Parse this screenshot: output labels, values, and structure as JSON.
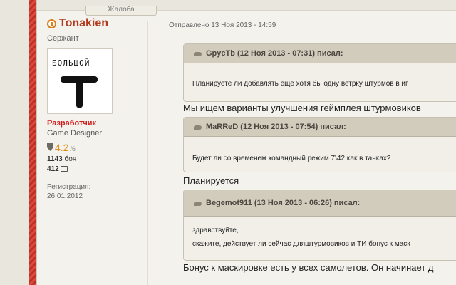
{
  "top_button": {
    "label": "Жалоба"
  },
  "author": {
    "name": "Tonakien",
    "rank": "Сержант",
    "avatar_text": "БОЛЬШОЙ",
    "role": "Разработчик",
    "position": "Game Designer",
    "rating": "4.2",
    "rating_max": "/6",
    "battles_value": "1143",
    "battles_label": "боя",
    "comments_value": "412",
    "reg_label": "Регистрация:",
    "reg_date": "26.01.2012"
  },
  "post": {
    "sent": "Отправлено 13 Ноя 2013 - 14:59"
  },
  "blocks": [
    {
      "quote_header": "GpycTb (12 Ноя 2013 - 07:31) писал:",
      "quote_lines": [
        "Планируете ли добавлять еще хотя бы одну ветрку штурмов в иг"
      ],
      "reply": "Мы ищем варианты улучшения геймплея штурмовиков"
    },
    {
      "quote_header": "MaRReD (12 Ноя 2013 - 07:54) писал:",
      "quote_lines": [
        "Будет ли со временем командный режим 7\\42 как в танках?"
      ],
      "reply": "Планируется"
    },
    {
      "quote_header": "Begemot911 (13 Ноя 2013 - 06:26) писал:",
      "quote_lines": [
        "здравствуйте,",
        "скажите, действует ли сейчас дляштурмовиков и ТИ бонус к маск"
      ],
      "reply": "Бонус к маскировке есть у всех самолетов. Он начинает д"
    }
  ],
  "colors": {
    "username": "#b23a1e",
    "role": "#d21d1d",
    "rating": "#e0901c",
    "stripe": "#e0483a"
  }
}
